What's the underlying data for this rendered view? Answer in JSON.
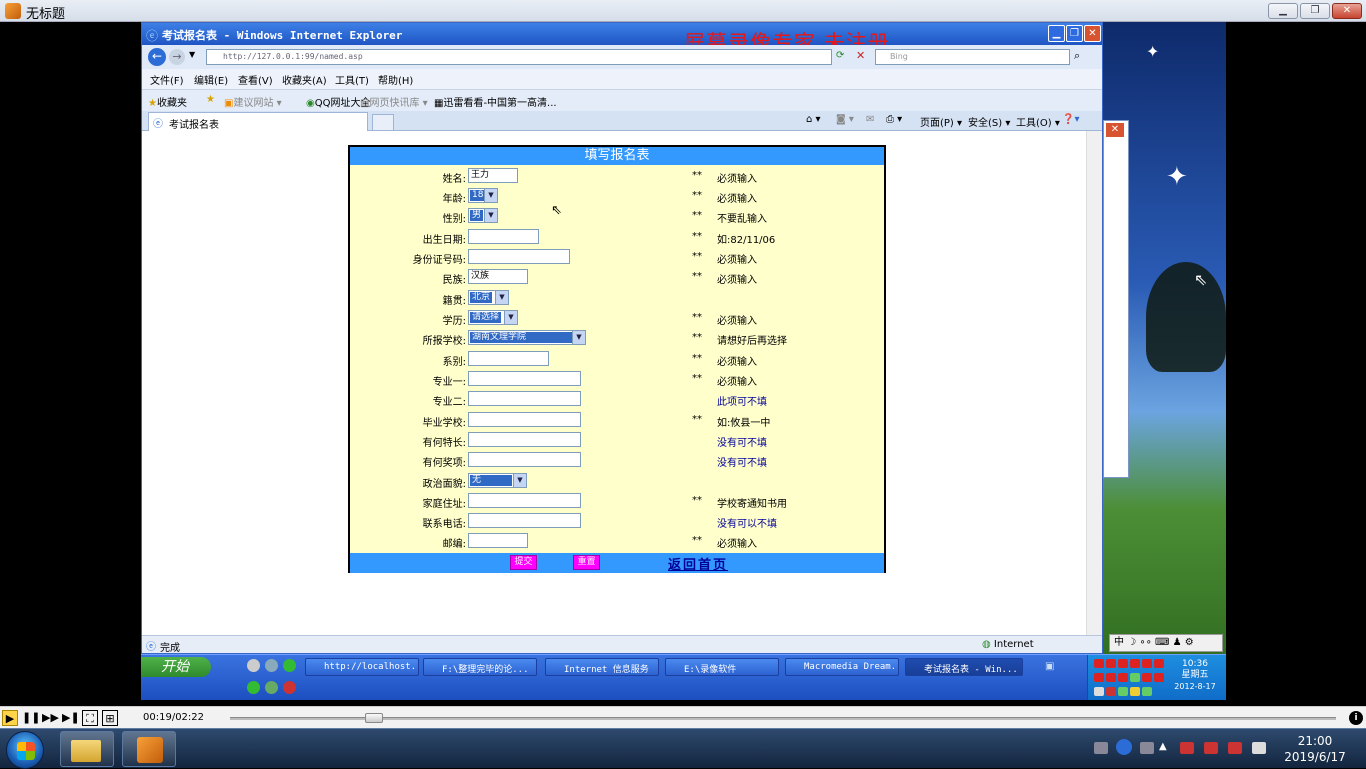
{
  "player": {
    "title": "无标题",
    "controls": {
      "time": "00:19/02:22",
      "progress_fraction": 0.13
    }
  },
  "watermark": "屏幕录像专家 未注册",
  "ie": {
    "title": "考试报名表 - Windows Internet Explorer",
    "address": "http://127.0.0.1:99/named.asp",
    "search_placeholder": "Bing",
    "menu": [
      "文件(F)",
      "编辑(E)",
      "查看(V)",
      "收藏夹(A)",
      "工具(T)",
      "帮助(H)"
    ],
    "favorites": [
      "收藏夹",
      "建议网站",
      "QQ网址大全",
      "网页快讯库",
      "迅雷看看-中国第一高清..."
    ],
    "tab_label": "考试报名表",
    "commands": [
      "页面(P)",
      "安全(S)",
      "工具(O)"
    ],
    "status": "完成",
    "zone": "Internet"
  },
  "form": {
    "header": "填写报名表",
    "rows": [
      {
        "label": "姓名:",
        "value": "王力",
        "star": "**",
        "note": "必须输入"
      },
      {
        "label": "年龄:",
        "value": "18",
        "star": "**",
        "note": "必须输入"
      },
      {
        "label": "性别:",
        "value": "男",
        "star": "**",
        "note": "不要乱输入"
      },
      {
        "label": "出生日期:",
        "value": "",
        "star": "**",
        "note": "如:82/11/06"
      },
      {
        "label": "身份证号码:",
        "value": "",
        "star": "**",
        "note": "必须输入"
      },
      {
        "label": "民族:",
        "value": "汉族",
        "star": "**",
        "note": "必须输入"
      },
      {
        "label": "籍贯:",
        "value": "北京",
        "star": "",
        "note": ""
      },
      {
        "label": "学历:",
        "value": "请选择",
        "star": "**",
        "note": "必须输入"
      },
      {
        "label": "所报学校:",
        "value": "湖南文理学院",
        "star": "**",
        "note": "请想好后再选择"
      },
      {
        "label": "系别:",
        "value": "",
        "star": "**",
        "note": "必须输入"
      },
      {
        "label": "专业一:",
        "value": "",
        "star": "**",
        "note": "必须输入"
      },
      {
        "label": "专业二:",
        "value": "",
        "star": "",
        "note": "此项可不填"
      },
      {
        "label": "毕业学校:",
        "value": "",
        "star": "**",
        "note": "如:攸县一中"
      },
      {
        "label": "有何特长:",
        "value": "",
        "star": "",
        "note": "没有可不填"
      },
      {
        "label": "有何奖项:",
        "value": "",
        "star": "",
        "note": "没有可不填"
      },
      {
        "label": "政治面貌:",
        "value": "无",
        "star": "",
        "note": ""
      },
      {
        "label": "家庭住址:",
        "value": "",
        "star": "**",
        "note": "学校寄通知书用"
      },
      {
        "label": "联系电话:",
        "value": "",
        "star": "",
        "note": "没有可以不填"
      },
      {
        "label": "邮编:",
        "value": "",
        "star": "**",
        "note": "必须输入"
      }
    ],
    "submit": "提交",
    "reset": "重置",
    "home_link": "返回首页"
  },
  "xp_taskbar": {
    "start": "开始",
    "tasks": [
      "http://localhost...",
      "F:\\整理完毕的论...",
      "Internet 信息服务",
      "E:\\录像软件",
      "Macromedia Dream...",
      "考试报名表 - Win..."
    ],
    "time": "10:36",
    "weekday": "星期五",
    "date": "2012-8-17"
  },
  "ime": "中 ☽ ∘∘ ⌨ ♟ ⚙",
  "w7_taskbar": {
    "time": "21:00",
    "date": "2019/6/17"
  }
}
